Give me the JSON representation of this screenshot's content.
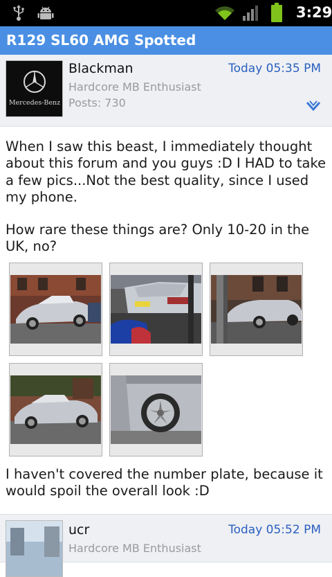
{
  "status_bar": {
    "time": "3:29",
    "icons": [
      "usb-icon",
      "android-debug-icon",
      "wifi-icon",
      "signal-icon",
      "battery-icon"
    ]
  },
  "thread": {
    "title": "R129 SL60 AMG Spotted"
  },
  "posts": [
    {
      "author": "Blackman",
      "rank": "Hardcore MB Enthusiast",
      "posts": "Posts: 730",
      "timestamp": "Today 05:35 PM",
      "avatar_text": "Mercedes-Benz",
      "paragraphs": [
        "When I saw this beast, I immediately thought about this forum and you guys :D I HAD to take a few pics...Not the best quality, since I used my phone.",
        "How rare these things are? Only 10-20 in the UK, no?",
        "I haven't covered the number plate, because it would spoil the overall look :D"
      ],
      "attachments": [
        "attachment-1",
        "attachment-2",
        "attachment-3",
        "attachment-4",
        "attachment-5"
      ]
    },
    {
      "author": "ucr",
      "rank": "Hardcore MB Enthusiast",
      "timestamp": "Today 05:52 PM"
    }
  ],
  "colors": {
    "title_bar": "#4a8fe4",
    "timestamp": "#2a5fbf",
    "header_bg": "#eef0f4"
  }
}
